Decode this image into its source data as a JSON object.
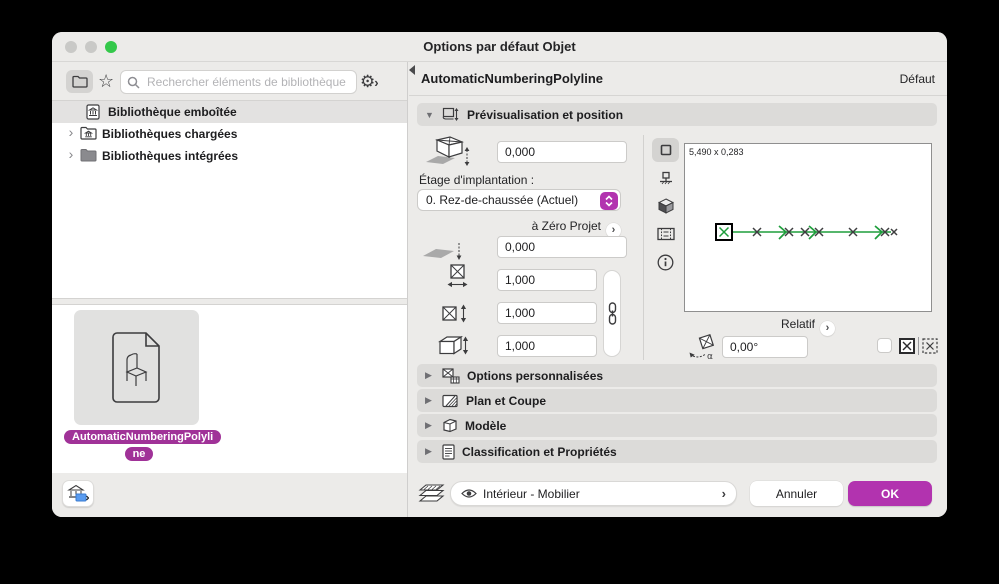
{
  "window": {
    "title": "Options par défaut Objet"
  },
  "icons": {
    "chevron_right": "›",
    "disclosure_open": "▼",
    "disclosure_closed": "▶",
    "gear": "⚙",
    "star": "☆"
  },
  "sidebar": {
    "search": {
      "placeholder": "Rechercher éléments de bibliothèque"
    },
    "tree": [
      {
        "label": "Bibliothèque emboîtée"
      },
      {
        "label": "Bibliothèques chargées"
      },
      {
        "label": "Bibliothèques intégrées"
      }
    ],
    "preview_tag": "AutomaticNumberingPolyline"
  },
  "main": {
    "object_name": "AutomaticNumberingPolyline",
    "default_label": "Défaut",
    "section_preview_title": "Prévisualisation et position",
    "fields": {
      "elevation_value": "0,000",
      "story_label": "Étage d'implantation :",
      "story_value": "0. Rez-de-chaussée (Actuel)",
      "zero_ref_label": "à Zéro Projet",
      "offset_value": "0,000",
      "width_value": "1,000",
      "height_value": "1,000",
      "depth_value": "1,000",
      "relative_label": "Relatif",
      "rotation_value": "0,00°"
    },
    "preview": {
      "size_label": "5,490 x 0,283"
    },
    "collapsed_sections": [
      {
        "label": "Options personnalisées"
      },
      {
        "label": "Plan et Coupe"
      },
      {
        "label": "Modèle"
      },
      {
        "label": "Classification et Propriétés"
      }
    ],
    "footer": {
      "layer_value": "Intérieur - Mobilier",
      "cancel_label": "Annuler",
      "ok_label": "OK"
    }
  },
  "colors": {
    "accent": "#b233af",
    "tag": "#a03298",
    "polyline_green": "#1e9e3c"
  }
}
